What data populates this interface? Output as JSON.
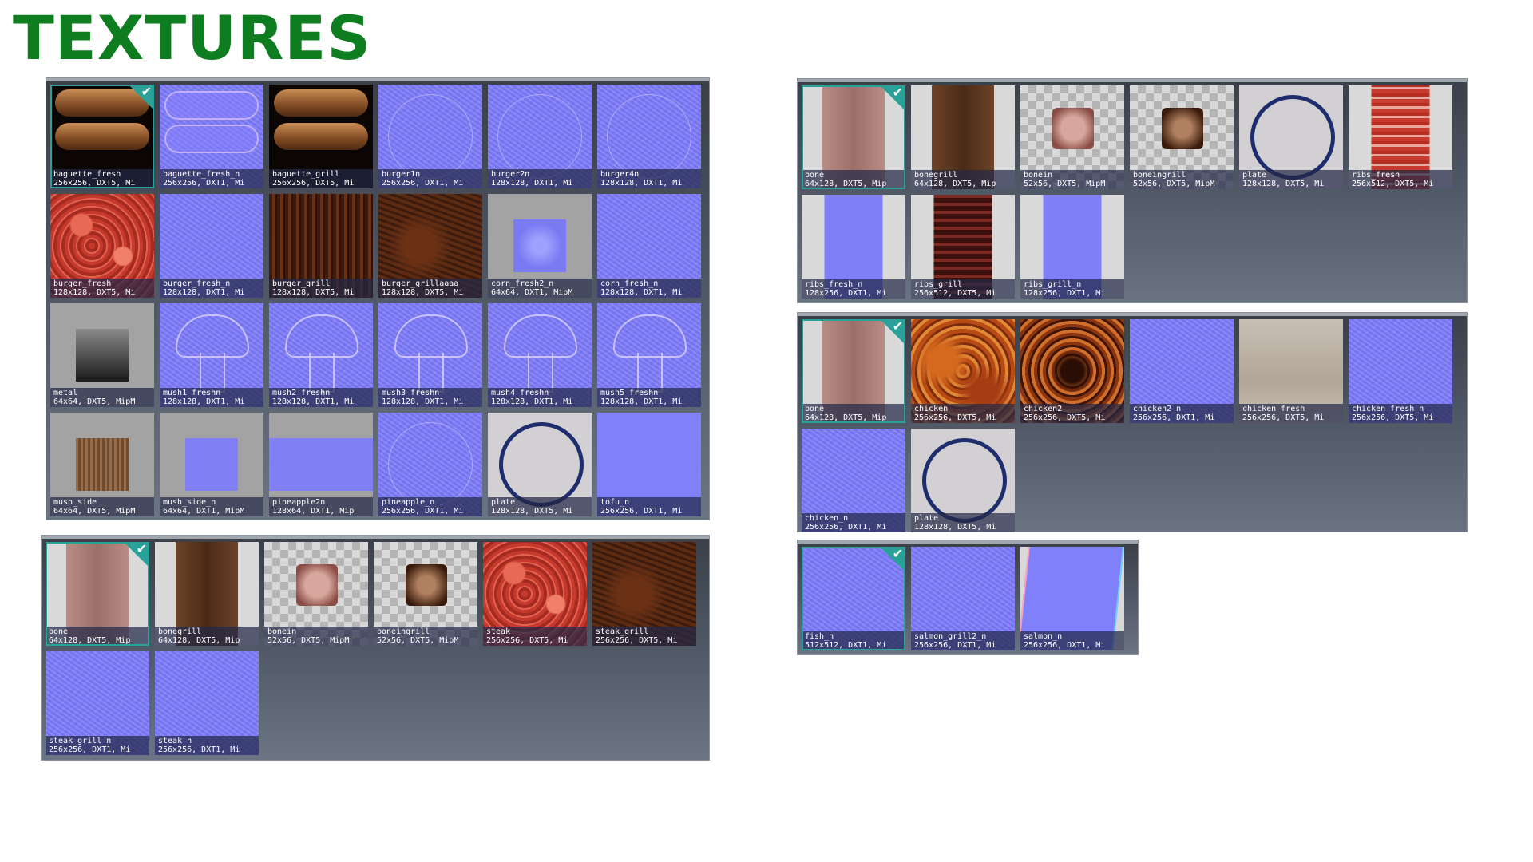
{
  "title": "TEXTURES",
  "colors": {
    "title": "#0e7d1f",
    "selection": "#2aa198",
    "panel_bg": "#4e5663"
  },
  "panels": [
    {
      "name": "panel-burgers",
      "tiles": [
        {
          "name": "baguette_fresh",
          "info": "256x256, DXT5, Mi",
          "tex": "tex-bread",
          "selected": true
        },
        {
          "name": "baguette_fresh_n",
          "info": "256x256, DXT1, Mi",
          "tex": "normal tex-breadn"
        },
        {
          "name": "baguette_grill",
          "info": "256x256, DXT5, Mi",
          "tex": "tex-bread"
        },
        {
          "name": "burger1n",
          "info": "256x256, DXT1, Mi",
          "tex": "normal tex-ring"
        },
        {
          "name": "burger2n",
          "info": "128x128, DXT1, Mi",
          "tex": "normal tex-ring"
        },
        {
          "name": "burger4n",
          "info": "128x128, DXT1, Mi",
          "tex": "normal tex-ring"
        },
        {
          "name": "burger_fresh",
          "info": "128x128, DXT5, Mi",
          "tex": "tex-meat"
        },
        {
          "name": "burger_fresh_n",
          "info": "128x128, DXT1, Mi",
          "tex": "normal"
        },
        {
          "name": "burger_grill",
          "info": "128x128, DXT5, Mi",
          "tex": "tex-grill"
        },
        {
          "name": "burger_grillaaaa",
          "info": "128x128, DXT5, Mi",
          "tex": "tex-grill2"
        },
        {
          "name": "corn_fresh2_n",
          "info": "64x64, DXT1, MipM",
          "tex": "tex-cornsmall"
        },
        {
          "name": "corn_fresh_n",
          "info": "128x128, DXT1, Mi",
          "tex": "normal"
        },
        {
          "name": "metal",
          "info": "64x64, DXT5, MipM",
          "tex": "tex-metal"
        },
        {
          "name": "mush1_freshn",
          "info": "128x128, DXT1, Mi",
          "tex": "normal tex-shape"
        },
        {
          "name": "mush2_freshn",
          "info": "128x128, DXT1, Mi",
          "tex": "normal tex-shape"
        },
        {
          "name": "mush3_freshn",
          "info": "128x128, DXT1, Mi",
          "tex": "normal tex-shape"
        },
        {
          "name": "mush4_freshn",
          "info": "128x128, DXT1, Mi",
          "tex": "normal tex-shape"
        },
        {
          "name": "mush5_freshn",
          "info": "128x128, DXT1, Mi",
          "tex": "normal tex-shape"
        },
        {
          "name": "mush_side",
          "info": "64x64, DXT5, MipM",
          "tex": "tex-mushside"
        },
        {
          "name": "mush_side_n",
          "info": "64x64, DXT1, MipM",
          "tex": "tex-mushsiden"
        },
        {
          "name": "pineapple2n",
          "info": "128x64, DXT1, Mip",
          "tex": "tex-pineapple2n"
        },
        {
          "name": "pineapple_n",
          "info": "256x256, DXT1, Mi",
          "tex": "normal tex-ring"
        },
        {
          "name": "plate",
          "info": "128x128, DXT5, Mi",
          "tex": "tex-plate"
        },
        {
          "name": "tofu_n",
          "info": "256x256, DXT1, Mi",
          "tex": "normal-flat"
        }
      ]
    },
    {
      "name": "panel-steak",
      "tiles": [
        {
          "name": "bone",
          "info": "64x128, DXT5, Mip",
          "tex": "tex-bone",
          "selected": true
        },
        {
          "name": "bonegrill",
          "info": "64x128, DXT5, Mip",
          "tex": "tex-bonegrill"
        },
        {
          "name": "bonein",
          "info": "52x56, DXT5, MipM",
          "tex": "checker tex-meat-small"
        },
        {
          "name": "boneingrill",
          "info": "52x56, DXT5, MipM",
          "tex": "checker tex-grill-small"
        },
        {
          "name": "steak",
          "info": "256x256, DXT5, Mi",
          "tex": "tex-meat"
        },
        {
          "name": "steak_grill",
          "info": "256x256, DXT5, Mi",
          "tex": "tex-grill2"
        },
        {
          "name": "steak_grill_n",
          "info": "256x256, DXT1, Mi",
          "tex": "normal"
        },
        {
          "name": "steak_n",
          "info": "256x256, DXT1, Mi",
          "tex": "normal"
        }
      ]
    },
    {
      "name": "panel-ribs",
      "tiles": [
        {
          "name": "bone",
          "info": "64x128, DXT5, Mip",
          "tex": "tex-bone",
          "selected": true
        },
        {
          "name": "bonegrill",
          "info": "64x128, DXT5, Mip",
          "tex": "tex-bonegrill"
        },
        {
          "name": "bonein",
          "info": "52x56, DXT5, MipM",
          "tex": "checker tex-meat-small"
        },
        {
          "name": "boneingrill",
          "info": "52x56, DXT5, MipM",
          "tex": "checker tex-grill-small"
        },
        {
          "name": "plate",
          "info": "128x128, DXT5, Mi",
          "tex": "tex-plate"
        },
        {
          "name": "ribs_fresh",
          "info": "256x512, DXT5, Mi",
          "tex": "tex-ribs"
        },
        {
          "name": "ribs_fresh_n",
          "info": "128x256, DXT1, Mi",
          "tex": "tex-ribsn"
        },
        {
          "name": "ribs_grill",
          "info": "256x512, DXT5, Mi",
          "tex": "tex-ribsgrill"
        },
        {
          "name": "ribs_grill_n",
          "info": "128x256, DXT1, Mi",
          "tex": "tex-ribsn"
        }
      ]
    },
    {
      "name": "panel-chicken",
      "tiles": [
        {
          "name": "bone",
          "info": "64x128, DXT5, Mip",
          "tex": "tex-bone",
          "selected": true
        },
        {
          "name": "chicken",
          "info": "256x256, DXT5, Mi",
          "tex": "tex-chicken"
        },
        {
          "name": "chicken2",
          "info": "256x256, DXT5, Mi",
          "tex": "tex-chicken2"
        },
        {
          "name": "chicken2_n",
          "info": "256x256, DXT1, Mi",
          "tex": "normal"
        },
        {
          "name": "chicken_fresh",
          "info": "256x256, DXT5, Mi",
          "tex": "tex-skin"
        },
        {
          "name": "chicken_fresh_n",
          "info": "256x256, DXT5, Mi",
          "tex": "normal"
        },
        {
          "name": "chicken_n",
          "info": "256x256, DXT1, Mi",
          "tex": "normal"
        },
        {
          "name": "plate",
          "info": "128x128, DXT5, Mi",
          "tex": "tex-plate"
        }
      ]
    },
    {
      "name": "panel-fish",
      "tiles": [
        {
          "name": "fish_n",
          "info": "512x512, DXT1, Mi",
          "tex": "normal",
          "selected": true
        },
        {
          "name": "salmon_grill2_n",
          "info": "256x256, DXT1, Mi",
          "tex": "normal"
        },
        {
          "name": "salmon_n",
          "info": "256x256, DXT1, Mi",
          "tex": "tex-skew"
        }
      ]
    }
  ]
}
